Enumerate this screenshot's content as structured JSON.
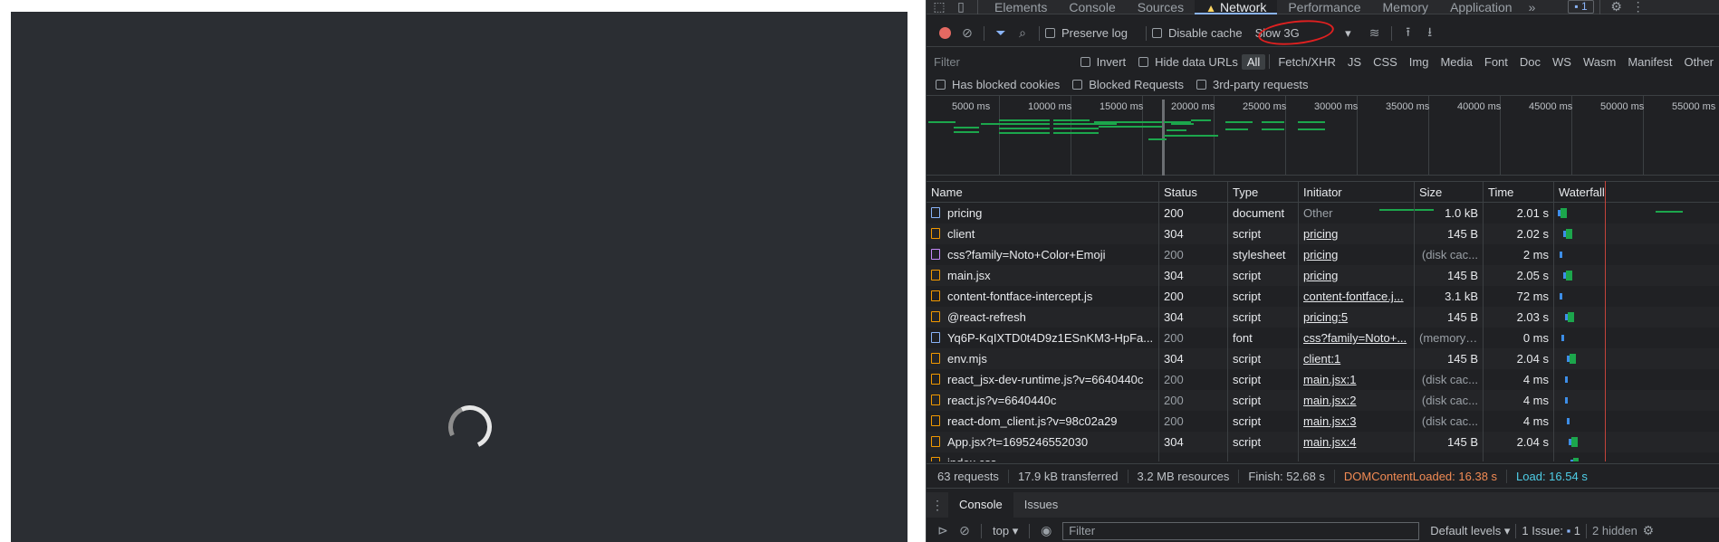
{
  "devtools": {
    "tabs": [
      "Elements",
      "Console",
      "Sources",
      "Network",
      "Performance",
      "Memory",
      "Application"
    ],
    "active_tab": "Network",
    "more_tabs": "»",
    "issues_badge": "1",
    "toolbar": {
      "preserve_log": "Preserve log",
      "disable_cache": "Disable cache",
      "throttling": "Slow 3G"
    },
    "filter": {
      "placeholder": "Filter",
      "invert": "Invert",
      "hide_data_urls": "Hide data URLs",
      "types": [
        "All",
        "Fetch/XHR",
        "JS",
        "CSS",
        "Img",
        "Media",
        "Font",
        "Doc",
        "WS",
        "Wasm",
        "Manifest",
        "Other"
      ],
      "active_type": "All",
      "has_blocked_cookies": "Has blocked cookies",
      "blocked_requests": "Blocked Requests",
      "third_party": "3rd-party requests"
    },
    "overview": {
      "ticks": [
        "5000 ms",
        "10000 ms",
        "15000 ms",
        "20000 ms",
        "25000 ms",
        "30000 ms",
        "35000 ms",
        "40000 ms",
        "45000 ms",
        "50000 ms",
        "55000 ms"
      ]
    },
    "table": {
      "headers": [
        "Name",
        "Status",
        "Type",
        "Initiator",
        "Size",
        "Time",
        "Waterfall"
      ],
      "rows": [
        {
          "icon": "doc",
          "name": "pricing",
          "status": "200",
          "type": "document",
          "initiator": "Other",
          "initiator_link": false,
          "size": "1.0 kB",
          "time": "2.01 s",
          "dim": false
        },
        {
          "icon": "js",
          "name": "client",
          "status": "304",
          "type": "script",
          "initiator": "pricing",
          "initiator_link": true,
          "size": "145 B",
          "time": "2.02 s",
          "dim": false
        },
        {
          "icon": "css",
          "name": "css?family=Noto+Color+Emoji",
          "status": "200",
          "type": "stylesheet",
          "initiator": "pricing",
          "initiator_link": true,
          "size": "(disk cac...",
          "time": "2 ms",
          "dim": true
        },
        {
          "icon": "js",
          "name": "main.jsx",
          "status": "304",
          "type": "script",
          "initiator": "pricing",
          "initiator_link": true,
          "size": "145 B",
          "time": "2.05 s",
          "dim": false
        },
        {
          "icon": "js",
          "name": "content-fontface-intercept.js",
          "status": "200",
          "type": "script",
          "initiator": "content-fontface.j...",
          "initiator_link": true,
          "size": "3.1 kB",
          "time": "72 ms",
          "dim": false
        },
        {
          "icon": "js",
          "name": "@react-refresh",
          "status": "304",
          "type": "script",
          "initiator": "pricing:5",
          "initiator_link": true,
          "size": "145 B",
          "time": "2.03 s",
          "dim": false
        },
        {
          "icon": "font",
          "name": "Yq6P-KqIXTD0t4D9z1ESnKM3-HpFa...",
          "status": "200",
          "type": "font",
          "initiator": "css?family=Noto+...",
          "initiator_link": true,
          "size": "(memory ...",
          "time": "0 ms",
          "dim": true
        },
        {
          "icon": "js",
          "name": "env.mjs",
          "status": "304",
          "type": "script",
          "initiator": "client:1",
          "initiator_link": true,
          "size": "145 B",
          "time": "2.04 s",
          "dim": false
        },
        {
          "icon": "js",
          "name": "react_jsx-dev-runtime.js?v=6640440c",
          "status": "200",
          "type": "script",
          "initiator": "main.jsx:1",
          "initiator_link": true,
          "size": "(disk cac...",
          "time": "4 ms",
          "dim": true
        },
        {
          "icon": "js",
          "name": "react.js?v=6640440c",
          "status": "200",
          "type": "script",
          "initiator": "main.jsx:2",
          "initiator_link": true,
          "size": "(disk cac...",
          "time": "4 ms",
          "dim": true
        },
        {
          "icon": "js",
          "name": "react-dom_client.js?v=98c02a29",
          "status": "200",
          "type": "script",
          "initiator": "main.jsx:3",
          "initiator_link": true,
          "size": "(disk cac...",
          "time": "4 ms",
          "dim": true
        },
        {
          "icon": "js",
          "name": "App.jsx?t=1695246552030",
          "status": "304",
          "type": "script",
          "initiator": "main.jsx:4",
          "initiator_link": true,
          "size": "145 B",
          "time": "2.04 s",
          "dim": false
        },
        {
          "icon": "js",
          "name": "index.css",
          "status": "",
          "type": "",
          "initiator": "",
          "initiator_link": false,
          "size": "",
          "time": "",
          "dim": false
        }
      ]
    },
    "status": {
      "requests": "63 requests",
      "transferred": "17.9 kB transferred",
      "resources": "3.2 MB resources",
      "finish": "Finish: 52.68 s",
      "dcl": "DOMContentLoaded: 16.38 s",
      "load": "Load: 16.54 s"
    },
    "drawer": {
      "tabs": [
        "Console",
        "Issues"
      ],
      "active_tab": "Console",
      "context": "top",
      "filter_placeholder": "Filter",
      "levels": "Default levels",
      "issues": "1 Issue:",
      "issues_count": "1",
      "hidden": "2 hidden"
    }
  },
  "colors": {
    "accent": "#8ab4f8",
    "record": "#e46962",
    "waterfall": "#1ca64c",
    "annotation": "#e02020"
  }
}
